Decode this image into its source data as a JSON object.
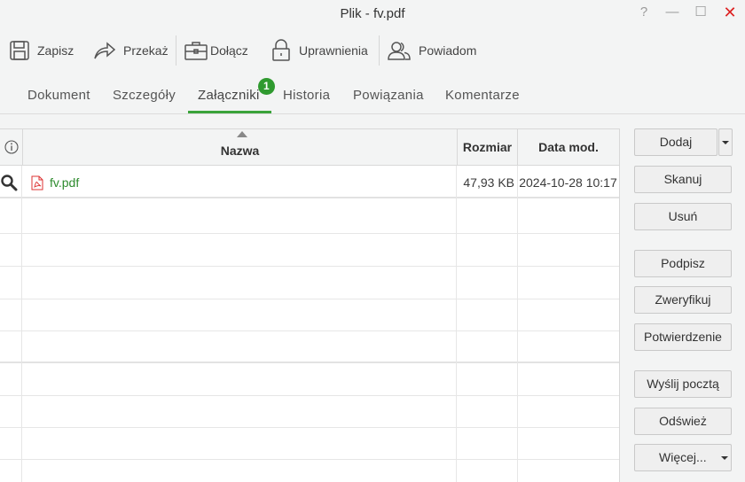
{
  "window": {
    "title": "Plik - fv.pdf",
    "help": "?",
    "minimize": "—",
    "maximize": "☐",
    "close": "✕"
  },
  "toolbar": {
    "save": "Zapisz",
    "forward": "Przekaż",
    "attach": "Dołącz",
    "permissions": "Uprawnienia",
    "notify": "Powiadom"
  },
  "tabs": {
    "document": "Dokument",
    "details": "Szczegóły",
    "attachments": "Załączniki",
    "attachments_badge": "1",
    "history": "Historia",
    "relations": "Powiązania",
    "comments": "Komentarze"
  },
  "grid": {
    "headers": {
      "name": "Nazwa",
      "size": "Rozmiar",
      "modified": "Data mod."
    },
    "rows": [
      {
        "name": "fv.pdf",
        "size": "47,93 KB",
        "modified": "2024-10-28 10:17"
      }
    ]
  },
  "side_buttons": {
    "add": "Dodaj",
    "scan": "Skanuj",
    "remove": "Usuń",
    "sign": "Podpisz",
    "verify": "Zweryfikuj",
    "confirmation": "Potwierdzenie",
    "send_mail": "Wyślij pocztą",
    "refresh": "Odśwież",
    "more": "Więcej..."
  },
  "colors": {
    "accent": "#3aa33a",
    "badge": "#2f9a2f",
    "file_link": "#2e8b2e",
    "close": "#dd2222",
    "pdf_icon": "#d33333"
  }
}
